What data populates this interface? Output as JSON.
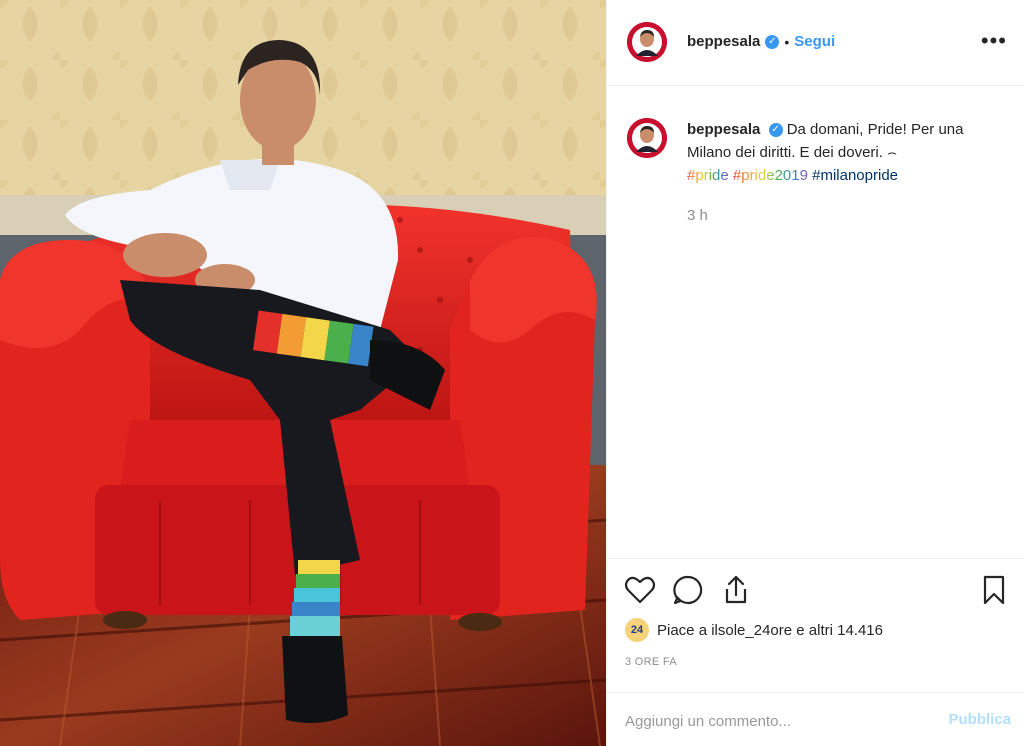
{
  "post": {
    "username": "beppesala",
    "verified_badge": "✓",
    "follow_separator": "•",
    "follow_label": "Segui",
    "more_icon": "more-dots-icon",
    "more_label": "•••"
  },
  "caption": {
    "username": "beppesala",
    "text": "Da domani, Pride! Per una Milano dei diritti. E dei doveri.",
    "emoji": "⌢",
    "hashtags": [
      "#pride",
      "#pride2019",
      "#milanopride"
    ]
  },
  "timestamp": "3 h",
  "actions": {
    "like_icon": "heart-icon",
    "comment_icon": "comment-icon",
    "share_icon": "share-icon",
    "save_icon": "bookmark-icon"
  },
  "likes": {
    "avatar_text": "24",
    "text": "Piace a ilsole_24ore e altri 14.416"
  },
  "date": "3 ORE FA",
  "comment": {
    "placeholder": "Aggiungi un commento...",
    "publish_label": "Pubblica"
  },
  "colors": {
    "accent": "#3897f0",
    "publish_disabled": "#b2dffc",
    "chair_red": "#d8191f"
  }
}
